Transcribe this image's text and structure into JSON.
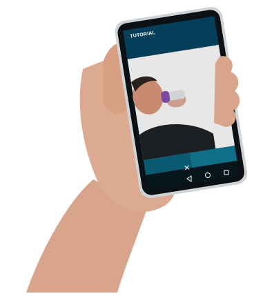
{
  "app": {
    "title": "TUTORIAL"
  },
  "controls": {
    "close_icon": "close-icon",
    "next_icon": "chevron-right-icon"
  },
  "nav": {
    "back_icon": "back-triangle-icon",
    "home_icon": "home-circle-icon",
    "recent_icon": "recent-square-icon"
  },
  "colors": {
    "header": "#063f59",
    "footer": "#0b5a72",
    "next_button": "#0f6f86",
    "nav_bar": "#07151c",
    "inhaler_purple": "#7b4a9e"
  }
}
